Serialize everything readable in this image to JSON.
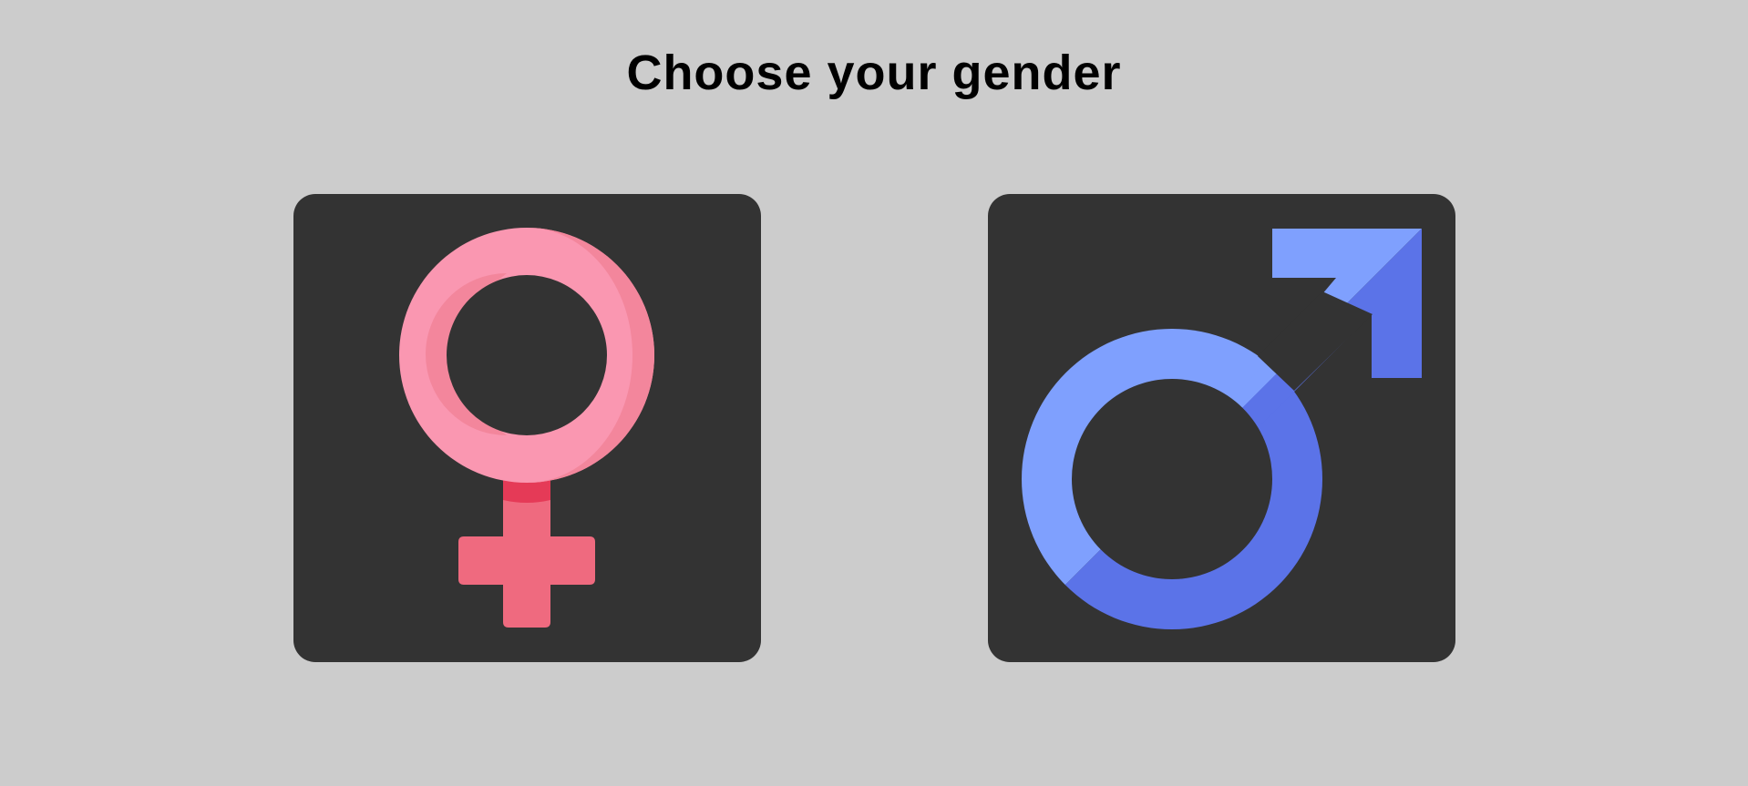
{
  "page": {
    "title": "Choose your gender"
  },
  "options": [
    {
      "icon": "female-symbol-icon"
    },
    {
      "icon": "male-symbol-icon"
    }
  ],
  "colors": {
    "background": "#cccccc",
    "card": "#333333",
    "female_ring": "#fa97b1",
    "female_ring_shade": "#f3869c",
    "female_cross": "#ef6a7f",
    "female_neck_shadow": "#e53a57",
    "male_light": "#7fa0fe",
    "male_dark": "#5b73e8"
  }
}
